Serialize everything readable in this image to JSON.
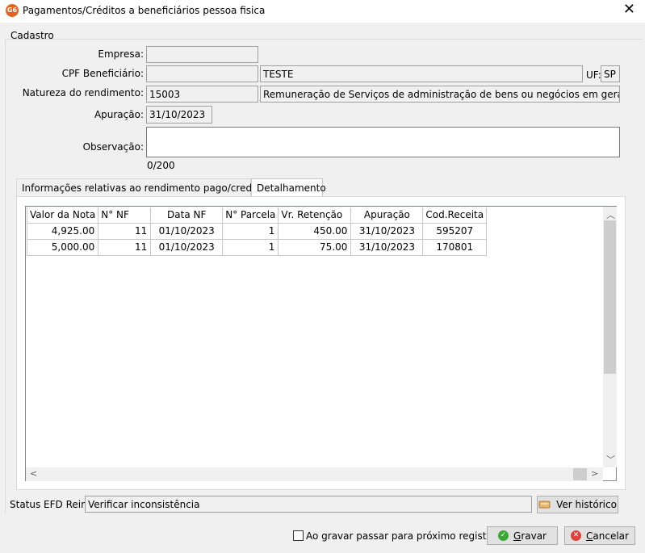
{
  "window": {
    "app_icon_text": "G6",
    "title": "Pagamentos/Créditos a beneficiários pessoa fisica",
    "close_glyph": "✕"
  },
  "cadastro": {
    "group_label": "Cadastro",
    "empresa_label": "Empresa:",
    "empresa_value": "",
    "cpf_label": "CPF Beneficiário:",
    "cpf_value": "",
    "beneficiario_nome": "TESTE",
    "uf_label": "UF:",
    "uf_value": "SP",
    "natureza_label": "Natureza do rendimento:",
    "natureza_codigo": "15003",
    "natureza_descricao": "Remuneração de Serviços de administração de bens ou negócios em geral, exceto c",
    "apuracao_label": "Apuração:",
    "apuracao_value": "31/10/2023",
    "observacao_label": "Observação:",
    "observacao_value": "",
    "observacao_counter": "0/200"
  },
  "tabs": [
    {
      "label": "Informações relativas ao rendimento pago/creditado",
      "active": false
    },
    {
      "label": "Detalhamento",
      "active": true
    }
  ],
  "grid": {
    "columns": [
      "Valor da Nota",
      "N° NF",
      "Data NF",
      "N° Parcela",
      "Vr. Retenção",
      "Apuração",
      "Cod.Receita"
    ],
    "rows": [
      [
        "4,925.00",
        "11",
        "01/10/2023",
        "1",
        "450.00",
        "31/10/2023",
        "595207"
      ],
      [
        "5,000.00",
        "11",
        "01/10/2023",
        "1",
        "75.00",
        "31/10/2023",
        "170801"
      ]
    ]
  },
  "status": {
    "label": "Status EFD Reinf:",
    "value": "Verificar inconsistência",
    "historico_button": "Ver histórico"
  },
  "footer": {
    "checkbox_label": "Ao gravar passar para próximo registro",
    "checkbox_checked": false,
    "gravar_button": "Gravar",
    "cancelar_button": "Cancelar"
  },
  "colors": {
    "gravar_icon": "#3aa935",
    "cancelar_icon": "#e0403a",
    "app_icon": "#e8611a"
  }
}
